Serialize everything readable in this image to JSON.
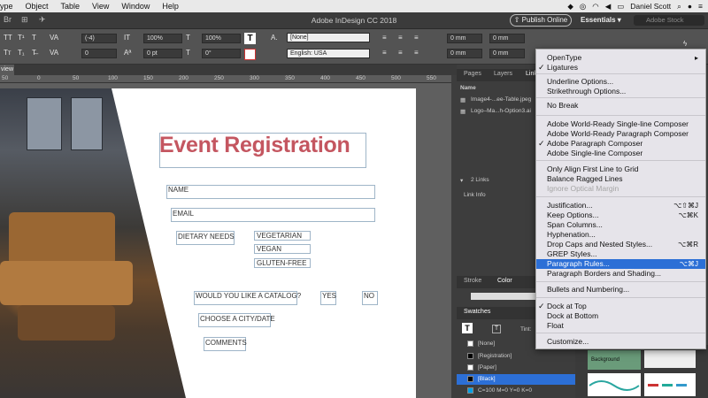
{
  "menubar": {
    "items": [
      "ype",
      "Object",
      "Table",
      "View",
      "Window",
      "Help"
    ],
    "user": "Daniel Scott"
  },
  "window": {
    "title": "Adobe InDesign CC 2018",
    "publish_label": "Publish Online",
    "workspace": "Essentials",
    "stock_placeholder": "Adobe Stock"
  },
  "control": {
    "tracking": "(-4)",
    "hscale": "100%",
    "vscale": "100%",
    "baseline": "0 pt",
    "skew": "0°",
    "kern": "0",
    "style": "[None]",
    "language": "English: USA",
    "size1": "0 mm",
    "size2": "0 mm",
    "size3": "0 mm",
    "size4": "0 mm"
  },
  "doc_tab": "view",
  "ruler_ticks": [
    "50",
    "0",
    "50",
    "100",
    "150",
    "200",
    "250",
    "300",
    "350",
    "400",
    "450",
    "500",
    "550"
  ],
  "form": {
    "title": "Event Registration",
    "name": "NAME",
    "email": "EMAIL",
    "dietary": "DIETARY NEEDS",
    "vegetarian": "VEGETARIAN",
    "vegan": "VEGAN",
    "gluten": "GLUTEN-FREE",
    "catalog": "WOULD YOU LIKE A CATALOG?",
    "yes": "YES",
    "no": "NO",
    "city": "CHOOSE A CITY/DATE",
    "comments": "COMMENTS"
  },
  "panels": {
    "tabs_top": [
      "Pages",
      "Layers",
      "Link"
    ],
    "links_header": "Name",
    "link1": "Image4-...ee-Table.jpeg",
    "link2": "Logo–Ma...h-Option3.ai",
    "link_count": "2 Links",
    "link_info": "Link Info",
    "stroke": "Stroke",
    "color": "Color",
    "swatches": "Swatches",
    "tint": "Tint:",
    "swatch_list": [
      "[None]",
      "[Registration]",
      "[Paper]",
      "[Black]",
      "C=100 M=0 Y=0 K=0"
    ],
    "thumb_label": "Background"
  },
  "menu": {
    "items": [
      {
        "label": "OpenType",
        "shortcut": "▸",
        "check": false,
        "disabled": false,
        "selected": false
      },
      {
        "label": "Ligatures",
        "shortcut": "",
        "check": true,
        "disabled": false,
        "selected": false
      },
      {
        "label": "Underline Options...",
        "shortcut": "",
        "check": false,
        "disabled": false,
        "selected": false
      },
      {
        "label": "Strikethrough Options...",
        "shortcut": "",
        "check": false,
        "disabled": false,
        "selected": false
      },
      {
        "label": "No Break",
        "shortcut": "",
        "check": false,
        "disabled": false,
        "selected": false
      },
      {
        "label": "Adobe World-Ready Single-line Composer",
        "shortcut": "",
        "check": false,
        "disabled": false,
        "selected": false
      },
      {
        "label": "Adobe World-Ready Paragraph Composer",
        "shortcut": "",
        "check": false,
        "disabled": false,
        "selected": false
      },
      {
        "label": "Adobe Paragraph Composer",
        "shortcut": "",
        "check": true,
        "disabled": false,
        "selected": false
      },
      {
        "label": "Adobe Single-line Composer",
        "shortcut": "",
        "check": false,
        "disabled": false,
        "selected": false
      },
      {
        "label": "Only Align First Line to Grid",
        "shortcut": "",
        "check": false,
        "disabled": false,
        "selected": false
      },
      {
        "label": "Balance Ragged Lines",
        "shortcut": "",
        "check": false,
        "disabled": false,
        "selected": false
      },
      {
        "label": "Ignore Optical Margin",
        "shortcut": "",
        "check": false,
        "disabled": true,
        "selected": false
      },
      {
        "label": "Justification...",
        "shortcut": "⌥⇧⌘J",
        "check": false,
        "disabled": false,
        "selected": false
      },
      {
        "label": "Keep Options...",
        "shortcut": "⌥⌘K",
        "check": false,
        "disabled": false,
        "selected": false
      },
      {
        "label": "Span Columns...",
        "shortcut": "",
        "check": false,
        "disabled": false,
        "selected": false
      },
      {
        "label": "Hyphenation...",
        "shortcut": "",
        "check": false,
        "disabled": false,
        "selected": false
      },
      {
        "label": "Drop Caps and Nested Styles...",
        "shortcut": "⌥⌘R",
        "check": false,
        "disabled": false,
        "selected": false
      },
      {
        "label": "GREP Styles...",
        "shortcut": "",
        "check": false,
        "disabled": false,
        "selected": false
      },
      {
        "label": "Paragraph Rules...",
        "shortcut": "⌥⌘J",
        "check": false,
        "disabled": false,
        "selected": true
      },
      {
        "label": "Paragraph Borders and Shading...",
        "shortcut": "",
        "check": false,
        "disabled": false,
        "selected": false
      },
      {
        "label": "Bullets and Numbering...",
        "shortcut": "",
        "check": false,
        "disabled": false,
        "selected": false
      },
      {
        "label": "Dock at Top",
        "shortcut": "",
        "check": true,
        "disabled": false,
        "selected": false
      },
      {
        "label": "Dock at Bottom",
        "shortcut": "",
        "check": false,
        "disabled": false,
        "selected": false
      },
      {
        "label": "Float",
        "shortcut": "",
        "check": false,
        "disabled": false,
        "selected": false
      },
      {
        "label": "Customize...",
        "shortcut": "",
        "check": false,
        "disabled": false,
        "selected": false
      }
    ]
  },
  "colors": {
    "accent": "#2c6fd6",
    "title_red": "#c45660"
  }
}
